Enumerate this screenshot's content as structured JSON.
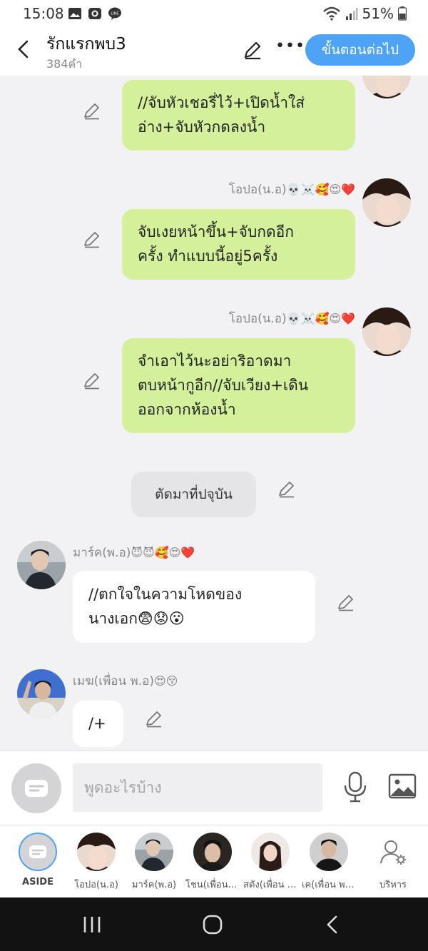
{
  "status": {
    "time": "15:08",
    "battery": "51%"
  },
  "header": {
    "title": "รักแรกพบ3",
    "word_count": "384คำ",
    "next_label": "ขั้นตอนต่อไป"
  },
  "messages": {
    "m1": {
      "lines": [
        "//จับหัวเชอรี่ไว้+เปิดน้ำใส่",
        "อ่าง+จับหัวกดลงน้ำ"
      ]
    },
    "m2": {
      "name": "โอปอ(น.อ)",
      "emoji": "💀☠️🥰😍❤️",
      "lines": [
        "จับเงยหน้าขึ้น+จับกดอีก",
        "ครั้ง ทำแบบนี้อยู่5ครั้ง"
      ]
    },
    "m3": {
      "name": "โอปอ(น.อ)",
      "emoji": "💀☠️🥰😍❤️",
      "lines": [
        "จำเอาไว้นะอย่าริอาดมา",
        "ตบหน้ากูอีก//จับเวียง+เดิน",
        "ออกจากห้องน้ำ"
      ]
    },
    "narration": "ตัดมาที่ปจุบัน",
    "m4": {
      "name": "มาร์ค(พ.อ)",
      "emoji": "😈😈🥰😍❤️",
      "lines": [
        "//ตกใจในความโหดของ",
        "นางเอก😨😟😮"
      ]
    },
    "m5": {
      "name": "เมฆ(เพื่อน พ.อ)",
      "emoji": "😍😚",
      "lines": [
        "/+"
      ]
    }
  },
  "composer": {
    "placeholder": "พูดอะไรบ้าง"
  },
  "characters": {
    "aside": "ASIDE",
    "c1": "โอปอ(น.อ)",
    "c2": "มาร์ค(พ.อ)",
    "c3": "โชน(เพื่อน พ.อ)",
    "c4": "สตัง(เพื่อน น.อ)",
    "c5": "เค(เพื่อน พ.อ)",
    "manage": "บริหาร"
  },
  "colors": {
    "accent": "#4da3f5",
    "bubble_self": "#d5f09a",
    "bubble_other": "#ffffff"
  }
}
